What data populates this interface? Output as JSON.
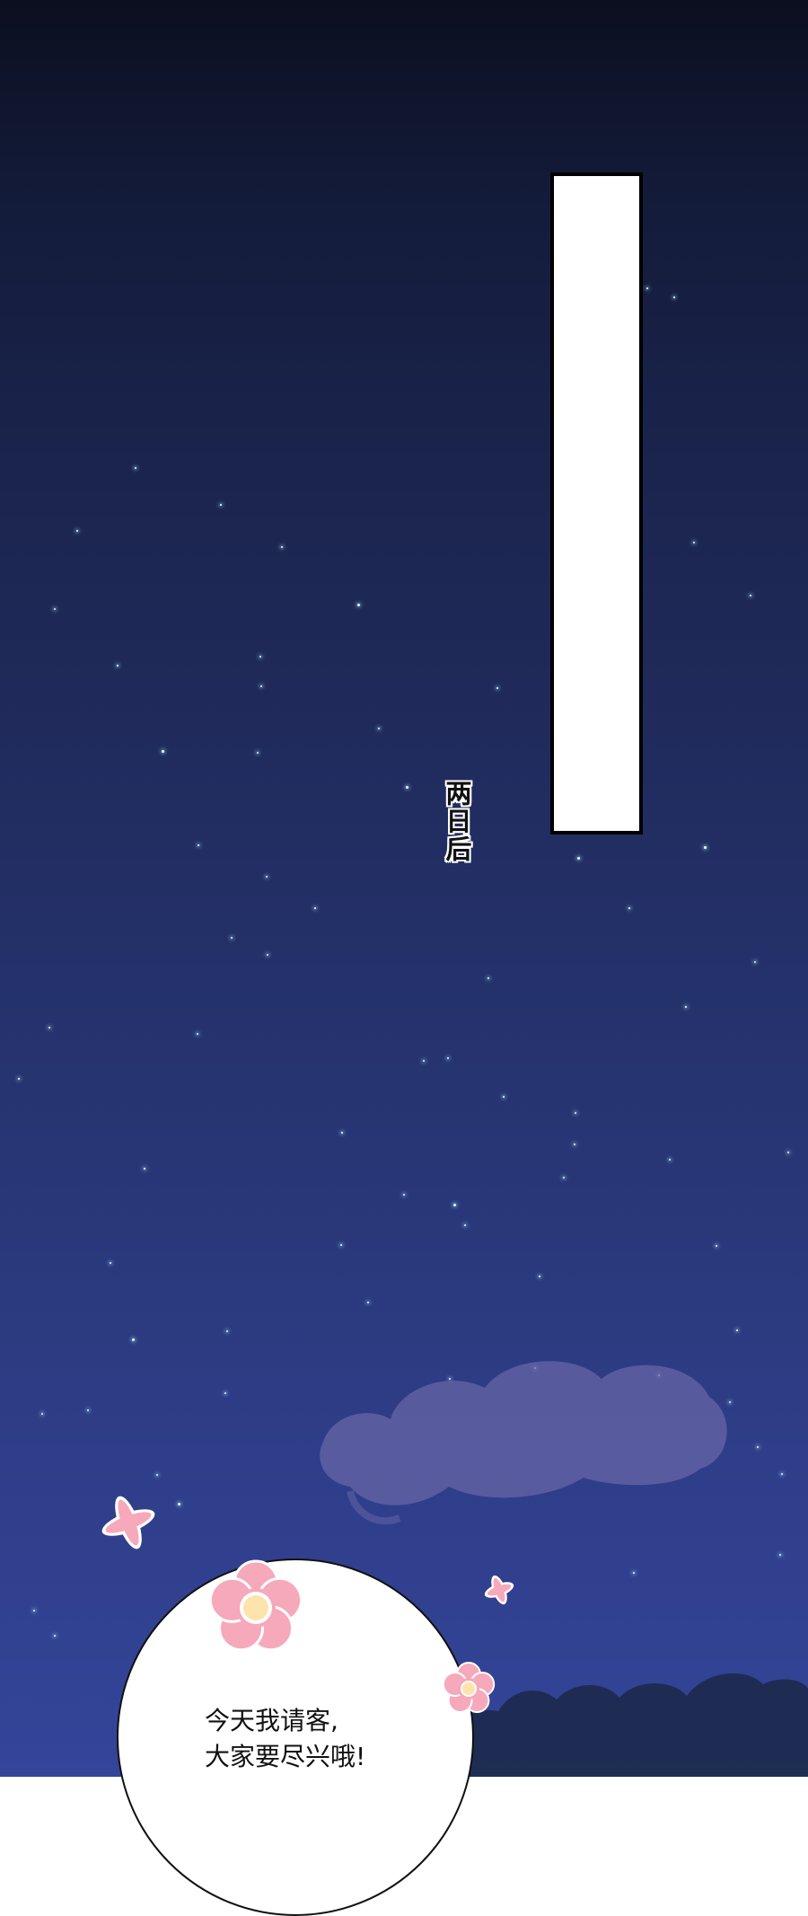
{
  "panel_caption": "两日后",
  "speech_bubble": {
    "line1": "今天我请客,",
    "line2": "大家要尽兴哦!"
  },
  "colors": {
    "sky_top": "#0b0f1f",
    "sky_bottom": "#34459a",
    "flower_pink": "#f6a9bb",
    "flower_center": "#ffe3ad",
    "cloud": "#6a67a8"
  },
  "icons": [
    "sparkle-star",
    "cloud-shape",
    "flower-icon",
    "cross-petal-icon",
    "tree-silhouette"
  ]
}
